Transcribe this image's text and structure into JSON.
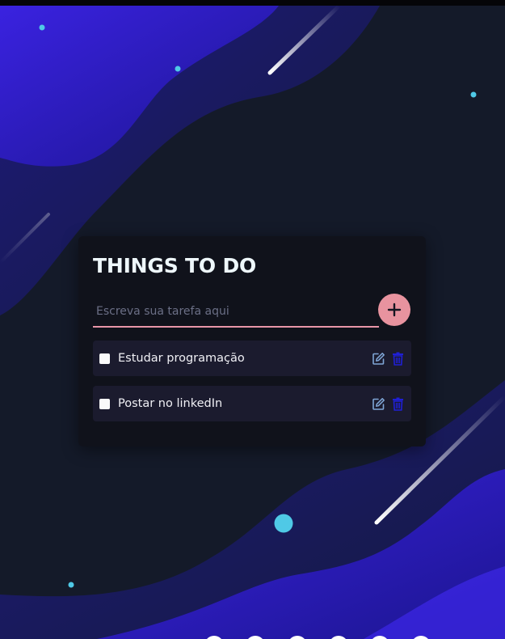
{
  "app": {
    "title": "THINGS TO DO"
  },
  "form": {
    "placeholder": "Escreva sua tarefa aqui",
    "value": "",
    "add_icon": "plus-icon"
  },
  "tasks": [
    {
      "label": "Estudar programação",
      "checked": false,
      "edit_icon": "edit-icon",
      "delete_icon": "trash-icon"
    },
    {
      "label": "Postar no linkedIn",
      "checked": false,
      "edit_icon": "edit-icon",
      "delete_icon": "trash-icon"
    }
  ],
  "colors": {
    "background": "#141a29",
    "card": "#10121b",
    "task": "#1b1b2e",
    "accent": "#e8939f",
    "wave": "#2f1fd1",
    "dot": "#4fc9e6",
    "edit_icon": "#7fa6d6",
    "delete_icon": "#1f1fd6"
  }
}
